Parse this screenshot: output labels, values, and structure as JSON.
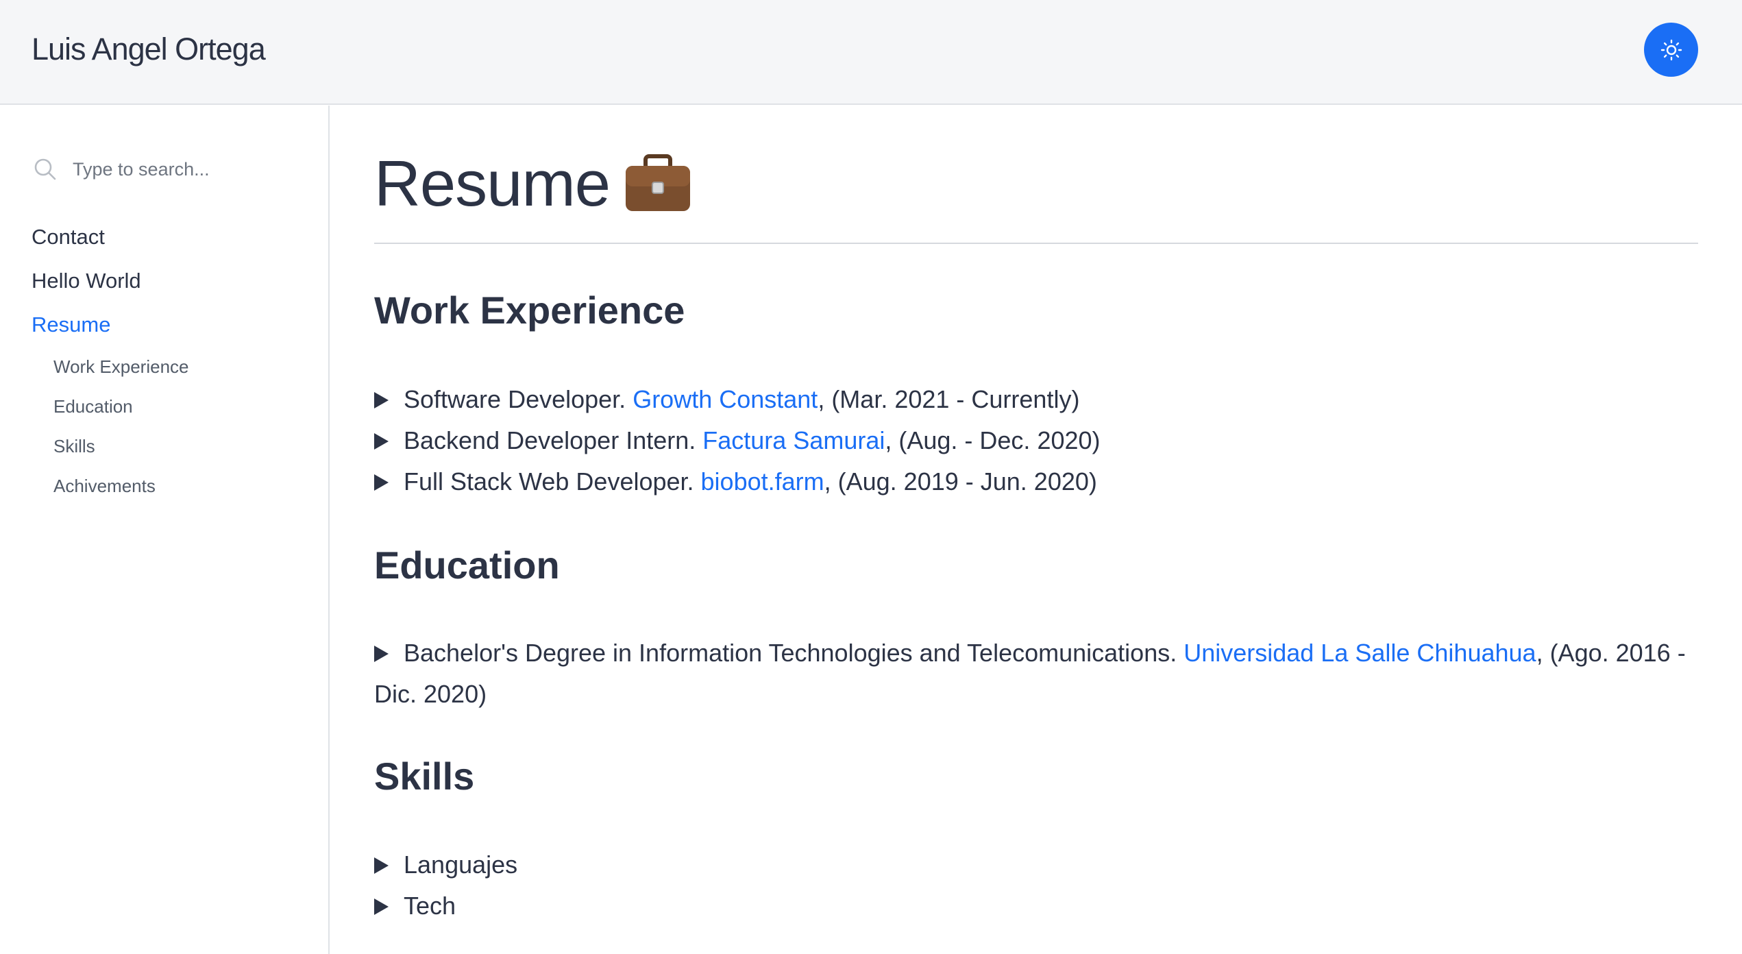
{
  "header": {
    "site_title": "Luis Angel Ortega"
  },
  "search": {
    "placeholder": "Type to search..."
  },
  "sidebar": {
    "items": [
      {
        "label": "Contact"
      },
      {
        "label": "Hello World"
      },
      {
        "label": "Resume"
      }
    ],
    "sub_items": [
      {
        "label": "Work Experience"
      },
      {
        "label": "Education"
      },
      {
        "label": "Skills"
      },
      {
        "label": "Achivements"
      }
    ]
  },
  "page": {
    "title": "Resume",
    "title_emoji": "💼"
  },
  "work": {
    "heading": "Work Experience",
    "items": [
      {
        "role": "Software Developer. ",
        "company": "Growth Constant",
        "period": ", (Mar. 2021 - Currently)"
      },
      {
        "role": "Backend Developer Intern. ",
        "company": "Factura Samurai",
        "period": ", (Aug. - Dec. 2020)"
      },
      {
        "role": "Full Stack Web Developer. ",
        "company": "biobot.farm",
        "period": ", (Aug. 2019 - Jun. 2020)"
      }
    ]
  },
  "education": {
    "heading": "Education",
    "items": [
      {
        "degree": "Bachelor's Degree in Information Technologies and Telecomunications. ",
        "school": "Universidad La Salle Chihuahua",
        "period": ", (Ago. 2016 - Dic. 2020)"
      }
    ]
  },
  "skills": {
    "heading": "Skills",
    "items": [
      {
        "label": "Languajes"
      },
      {
        "label": "Tech"
      }
    ]
  },
  "colors": {
    "accent": "#1a6ef5",
    "text": "#2c3345",
    "header_bg": "#f5f6f8"
  }
}
